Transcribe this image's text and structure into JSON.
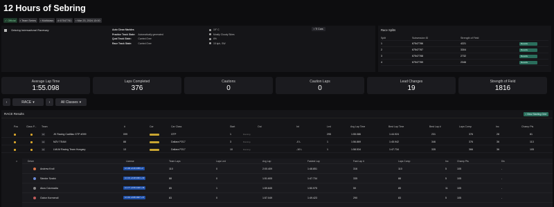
{
  "title": "12 Hours of Sebring",
  "badges": [
    "Official",
    "Team Series",
    "Multiclass",
    "67547781",
    "Mar 23, 2024 13:00"
  ],
  "track": "Sebring International Raceway",
  "conditions": [
    {
      "k": "Auto Clean Marbles",
      "v": ""
    },
    {
      "k": "Practice Track State:",
      "v": "Automatically generated"
    },
    {
      "k": "Qual Track State:",
      "v": "Carried Over"
    },
    {
      "k": "Race Track State:",
      "v": "Carried Over"
    }
  ],
  "weather": [
    "19° C",
    "Mostly Cloudy Skies",
    "6%",
    "15 kph, SW"
  ],
  "tcars_label": "Ti Cars",
  "splits": {
    "title": "Race Splits",
    "headers": [
      "Split",
      "Subsession ID",
      "Strength of Field",
      ""
    ],
    "rows": [
      {
        "split": "1",
        "id": "67547786",
        "sof": "4221",
        "btn": "Results"
      },
      {
        "split": "2",
        "id": "67547787",
        "sof": "3304",
        "btn": "Results"
      },
      {
        "split": "3",
        "id": "67547788",
        "sof": "2732",
        "btn": "Results"
      },
      {
        "split": "4",
        "id": "67547789",
        "sof": "2346",
        "btn": "Results"
      }
    ]
  },
  "stats": [
    {
      "label": "Average Lap Time",
      "value": "1:55.098"
    },
    {
      "label": "Laps Completed",
      "value": "376"
    },
    {
      "label": "Cautions",
      "value": "0"
    },
    {
      "label": "Caution Laps",
      "value": "0"
    },
    {
      "label": "Lead Changes",
      "value": "19"
    },
    {
      "label": "Strength of Field",
      "value": "1816"
    }
  ],
  "controls": {
    "session": "RACE",
    "classes": "All Classes"
  },
  "results": {
    "title": "RACE Results",
    "view_grid": "View Starting Grid",
    "columns": [
      "Pos",
      "Class P...",
      "Team",
      "#",
      "Car",
      "Car Class",
      "Start",
      "Out",
      "Int",
      "Led",
      "Avg Lap Time",
      "Best Lap Time",
      "Best Lap #",
      "Laps Comp",
      "Inc",
      "Champ Pts"
    ],
    "rows": [
      {
        "team": "JK Racing Cadillac GTP #099",
        "num": "099",
        "class": "GTP",
        "start": "1",
        "out": "Running",
        "int": "",
        "led": "295",
        "avg": "1:55.086",
        "best": "1:44.924",
        "bestlap": "231",
        "laps": "376",
        "inc": "28",
        "pts": "81"
      },
      {
        "team": "MZV TEAM",
        "num": "88",
        "class": "Dallara P217",
        "start": "3",
        "out": "Running",
        "int": "-0 L",
        "led": "1",
        "avg": "1:56.869",
        "best": "1:45.942",
        "bestlap": "346",
        "laps": "376",
        "inc": "36",
        "pts": "113"
      },
      {
        "team": "LMLM Racing Team Hungary",
        "num": "13",
        "class": "Dallara P217",
        "start": "10",
        "out": "Running",
        "int": "-10 L",
        "led": "1",
        "avg": "1:58.534",
        "best": "1:47.734",
        "bestlap": "335",
        "laps": "366",
        "inc": "36",
        "pts": "105"
      }
    ]
  },
  "drivers": {
    "columns": [
      "Driver",
      "License",
      "Team Laps",
      "Laps Led",
      "Avg Lap",
      "Fastest Lap",
      "Fast Lap #",
      "Laps Comp",
      "Inc",
      "Champ Pts",
      "Div"
    ],
    "rows": [
      {
        "name": "Andrew Kroll",
        "license": "A 3.96 +0.46 2359 +2",
        "laps": "110",
        "led": "0",
        "avg": "2:00.409",
        "fast": "1:48.851",
        "fastn": "316",
        "comp": "110",
        "inc": "5",
        "pts": "105",
        "div": "-"
      },
      {
        "name": "Sándor Szabó",
        "license": "A 4.31 +0.28 2304 +10",
        "laps": "88",
        "led": "0",
        "avg": "1:51.605",
        "fast": "1:47.734",
        "fastn": "335",
        "comp": "88",
        "inc": "5",
        "pts": "105",
        "div": "-"
      },
      {
        "name": "Akos Czizmadia",
        "license": "A 4.77 +0.59 1410 +16",
        "laps": "85",
        "led": "1",
        "avg": "1:59.845",
        "fast": "1:50.975",
        "fastn": "59",
        "comp": "85",
        "inc": "11",
        "pts": "105",
        "div": "-"
      },
      {
        "name": "Gabor Kormendi",
        "license": "A 4.91 +0.89 1607 +17",
        "laps": "83",
        "led": "0",
        "avg": "1:57.049",
        "fast": "1:49.423",
        "fastn": "290",
        "comp": "83",
        "inc": "5",
        "pts": "105",
        "div": "-"
      }
    ]
  }
}
